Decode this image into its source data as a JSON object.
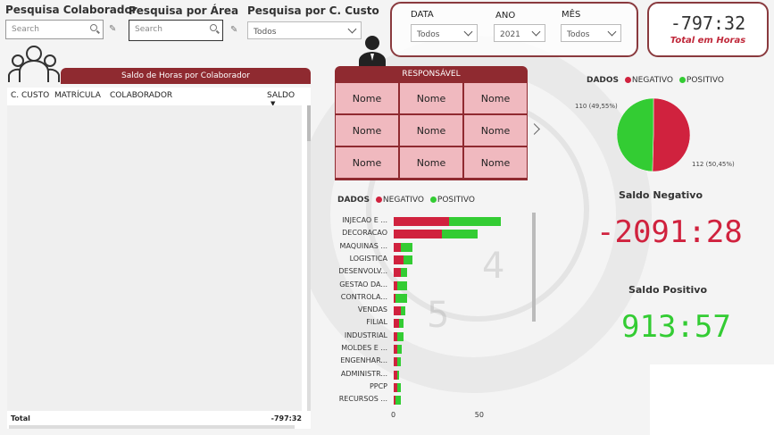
{
  "slicers": {
    "colaborador": {
      "title": "Pesquisa Colaborador",
      "placeholder": "Search"
    },
    "area": {
      "title": "Pesquisa por Área",
      "placeholder": "Search"
    },
    "custo": {
      "title": "Pesquisa por C. Custo",
      "value": "Todos"
    }
  },
  "filters": {
    "data": {
      "label": "DATA",
      "value": "Todos"
    },
    "ano": {
      "label": "ANO",
      "value": "2021"
    },
    "mes": {
      "label": "MÊS",
      "value": "Todos"
    }
  },
  "total_card": {
    "value": "-797:32",
    "label": "Total em Horas"
  },
  "table": {
    "title": "Saldo de Horas por Colaborador",
    "headers": [
      "C. CUSTO",
      "MATRÍCULA",
      "COLABORADOR",
      "SALDO"
    ],
    "total_label": "Total",
    "total_value": "-797:32"
  },
  "responsavel": {
    "title": "RESPONSÁVEL",
    "names": [
      "Nome",
      "Nome",
      "Nome",
      "Nome",
      "Nome",
      "Nome",
      "Nome",
      "Nome",
      "Nome"
    ]
  },
  "legend": {
    "prefix": "DADOS",
    "negativo": "NEGATIVO",
    "positivo": "POSITIVO"
  },
  "colors": {
    "negativo": "#d0223e",
    "positivo": "#33cc33",
    "header": "#8f2a30",
    "cell": "#f0b9bf"
  },
  "chart_data": [
    {
      "type": "bar",
      "orientation": "horizontal",
      "stacked": true,
      "categories": [
        "INJECAO E ...",
        "DECORACAO",
        "MAQUINAS ...",
        "LOGISTICA",
        "DESENVOLV...",
        "GESTAO DA...",
        "CONTROLA...",
        "VENDAS",
        "FILIAL",
        "INDUSTRIAL",
        "MOLDES E ...",
        "ENGENHAR...",
        "ADMINISTR...",
        "PPCP",
        "RECURSOS ..."
      ],
      "series": [
        {
          "name": "NEGATIVO",
          "values": [
            33,
            29,
            4,
            6,
            4,
            2,
            1,
            4,
            3,
            2,
            2,
            2,
            2,
            2,
            1
          ]
        },
        {
          "name": "POSITIVO",
          "values": [
            31,
            21,
            7,
            5,
            4,
            6,
            7,
            3,
            3,
            4,
            3,
            2,
            1,
            2,
            3
          ]
        }
      ],
      "xlim": [
        0,
        80
      ],
      "xticks": [
        "0",
        "50"
      ]
    },
    {
      "type": "pie",
      "labels": [
        "NEGATIVO",
        "POSITIVO"
      ],
      "values": [
        112,
        110
      ],
      "data_labels": [
        "112 (50,45%)",
        "110 (49,55%)"
      ]
    }
  ],
  "kpis": {
    "negativo": {
      "title": "Saldo Negativo",
      "value": "-2091:28"
    },
    "positivo": {
      "title": "Saldo Positivo",
      "value": "913:57"
    }
  }
}
